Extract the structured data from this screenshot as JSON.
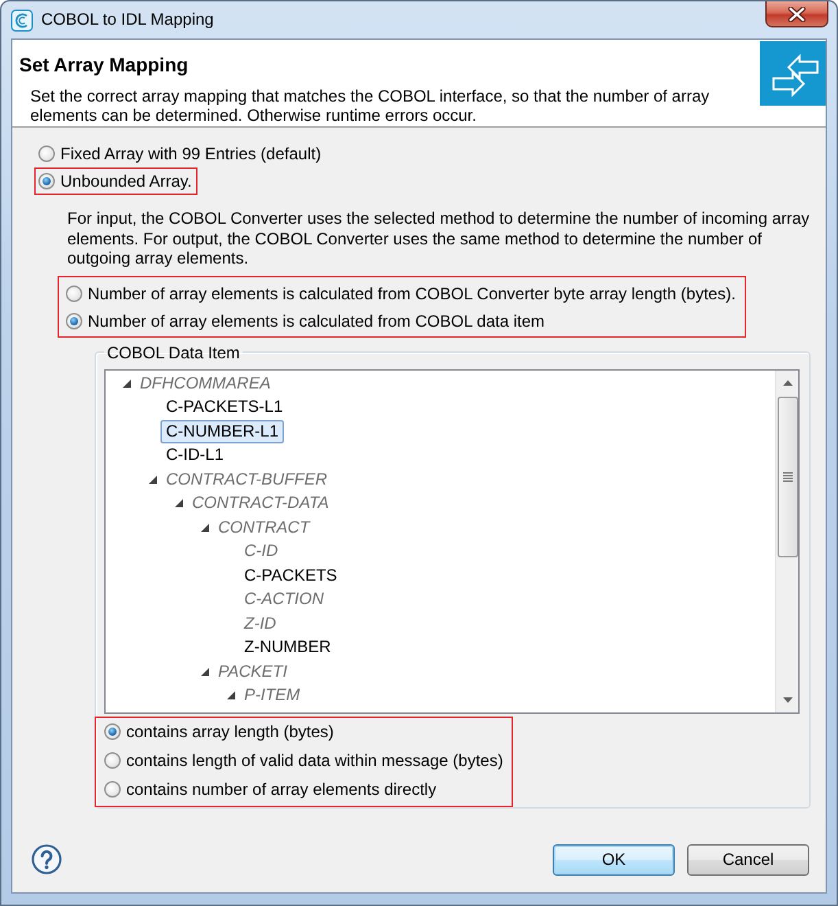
{
  "window": {
    "title": "COBOL to IDL Mapping"
  },
  "header": {
    "title": "Set Array Mapping",
    "description": "Set the correct array mapping that matches the COBOL interface, so that the number of array elements can be determined. Otherwise runtime errors occur."
  },
  "array_types": [
    {
      "label": "Fixed Array with 99 Entries (default)",
      "selected": false,
      "highlighted": false
    },
    {
      "label": "Unbounded Array.",
      "selected": true,
      "highlighted": true
    }
  ],
  "unbounded": {
    "description": "For input, the COBOL Converter uses the selected method to determine the number of incoming array elements. For output, the COBOL Converter uses the same method to determine the number of outgoing array elements.",
    "methods_highlighted": true,
    "methods": [
      {
        "label": "Number of array elements is calculated from COBOL Converter byte array length (bytes).",
        "selected": false
      },
      {
        "label": "Number of array elements is calculated from COBOL data item",
        "selected": true
      }
    ]
  },
  "data_item": {
    "title": "COBOL Data Item",
    "tree": [
      {
        "label": "DFHCOMMAREA",
        "disabled": true,
        "selected": false,
        "expanded": true,
        "children": [
          {
            "label": "C-PACKETS-L1",
            "disabled": false,
            "selected": false
          },
          {
            "label": "C-NUMBER-L1",
            "disabled": false,
            "selected": true
          },
          {
            "label": "C-ID-L1",
            "disabled": false,
            "selected": false
          },
          {
            "label": "CONTRACT-BUFFER",
            "disabled": true,
            "selected": false,
            "expanded": true,
            "children": [
              {
                "label": "CONTRACT-DATA",
                "disabled": true,
                "selected": false,
                "expanded": true,
                "children": [
                  {
                    "label": "CONTRACT",
                    "disabled": true,
                    "selected": false,
                    "expanded": true,
                    "children": [
                      {
                        "label": "C-ID",
                        "disabled": true,
                        "selected": false
                      },
                      {
                        "label": "C-PACKETS",
                        "disabled": false,
                        "selected": false
                      },
                      {
                        "label": "C-ACTION",
                        "disabled": true,
                        "selected": false
                      },
                      {
                        "label": "Z-ID",
                        "disabled": true,
                        "selected": false
                      },
                      {
                        "label": "Z-NUMBER",
                        "disabled": false,
                        "selected": false
                      }
                    ]
                  },
                  {
                    "label": "PACKETI",
                    "disabled": true,
                    "selected": false,
                    "expanded": true,
                    "children": [
                      {
                        "label": "P-ITEM",
                        "disabled": true,
                        "selected": false,
                        "expanded": true
                      }
                    ]
                  }
                ]
              }
            ]
          }
        ]
      }
    ],
    "options_highlighted": true,
    "options": [
      {
        "label": "contains array length (bytes)",
        "selected": true
      },
      {
        "label": "contains length of valid data within message (bytes)",
        "selected": false
      },
      {
        "label": "contains number of array elements directly",
        "selected": false
      }
    ]
  },
  "buttons": [
    {
      "label": "OK",
      "default": true
    },
    {
      "label": "Cancel",
      "default": false
    }
  ]
}
